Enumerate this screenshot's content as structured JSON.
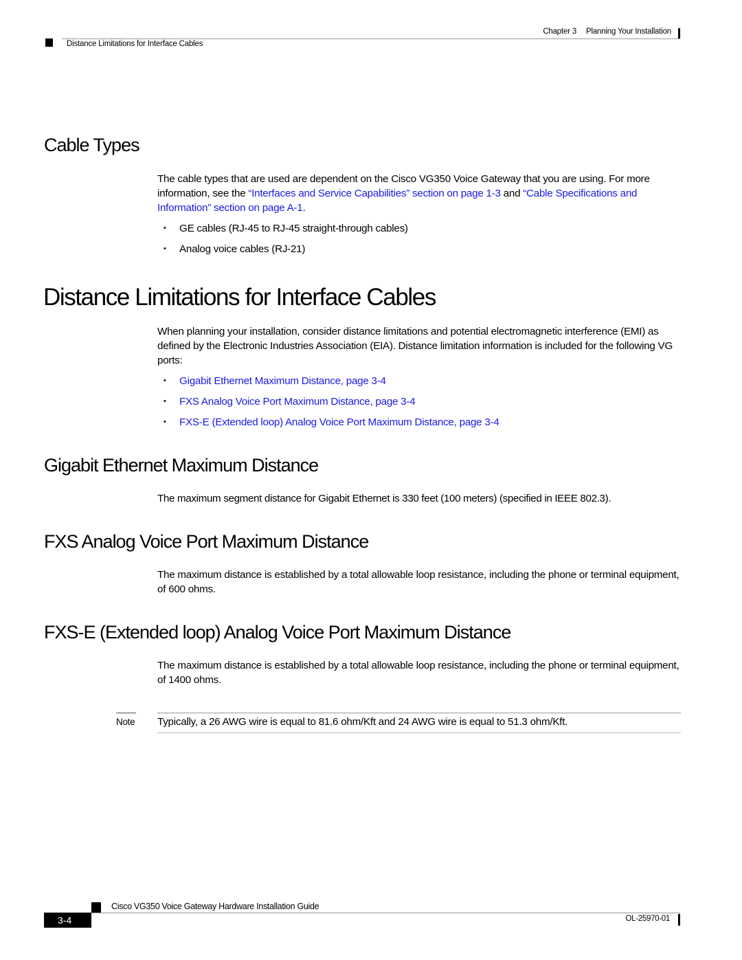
{
  "header": {
    "chapter": "Chapter 3",
    "chapter_title": "Planning Your Installation",
    "section": "Distance Limitations for Interface Cables"
  },
  "cable_types": {
    "heading": "Cable Types",
    "para_pre": "The cable types that are used are dependent on the Cisco VG350 Voice Gateway that you are using. For more information, see the ",
    "link1": "“Interfaces and Service Capabilities” section on page 1-3",
    "para_mid": " and ",
    "link2": "“Cable Specifications and Information” section on page A-1",
    "para_post": ".",
    "bullets": [
      "GE cables (RJ-45 to RJ-45 straight-through cables)",
      "Analog voice cables (RJ-21)"
    ]
  },
  "distance": {
    "heading": "Distance Limitations for Interface Cables",
    "para": "When planning your installation, consider distance limitations and potential electromagnetic interference (EMI) as defined by the Electronic Industries Association (EIA). Distance limitation information is included for the following VG ports:",
    "links": [
      "Gigabit Ethernet Maximum Distance, page 3-4",
      "FXS Analog Voice Port Maximum Distance, page 3-4",
      "FXS-E (Extended loop) Analog Voice Port Maximum Distance, page 3-4"
    ]
  },
  "gige": {
    "heading": "Gigabit Ethernet Maximum Distance",
    "para": "The maximum segment distance for Gigabit Ethernet is 330 feet (100 meters) (specified in IEEE 802.3)."
  },
  "fxs": {
    "heading": "FXS Analog Voice Port Maximum Distance",
    "para": "The maximum distance is established by a total allowable loop resistance, including the phone or terminal equipment, of 600 ohms."
  },
  "fxse": {
    "heading": "FXS-E (Extended loop) Analog Voice Port Maximum Distance",
    "para": "The maximum distance is established by a total allowable loop resistance, including the phone or terminal equipment, of 1400 ohms."
  },
  "note": {
    "label": "Note",
    "text": "Typically, a 26 AWG wire is equal to 81.6 ohm/Kft and 24 AWG wire is equal to 51.3 ohm/Kft."
  },
  "footer": {
    "guide_title": "Cisco VG350 Voice Gateway Hardware Installation Guide",
    "page_number": "3-4",
    "doc_number": "OL-25970-01"
  },
  "colors": {
    "link": "#1a1ae6",
    "text": "#000000"
  }
}
